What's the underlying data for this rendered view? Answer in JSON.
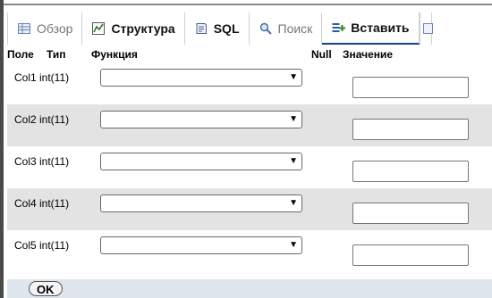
{
  "tabs": [
    {
      "label": "Обзор",
      "icon": "table-browse-icon",
      "style": "dim"
    },
    {
      "label": "Структура",
      "icon": "structure-icon",
      "style": "bold"
    },
    {
      "label": "SQL",
      "icon": "sql-icon",
      "style": "bold"
    },
    {
      "label": "Поиск",
      "icon": "search-icon",
      "style": "dim"
    },
    {
      "label": "Вставить",
      "icon": "insert-icon",
      "style": "bold"
    }
  ],
  "header": {
    "field": "Поле",
    "type": "Тип",
    "function": "Функция",
    "null": "Null",
    "value": "Значение"
  },
  "rows": [
    {
      "name": "Col1",
      "type": "int(11)",
      "function": "",
      "value": ""
    },
    {
      "name": "Col2",
      "type": "int(11)",
      "function": "",
      "value": ""
    },
    {
      "name": "Col3",
      "type": "int(11)",
      "function": "",
      "value": ""
    },
    {
      "name": "Col4",
      "type": "int(11)",
      "function": "",
      "value": ""
    },
    {
      "name": "Col5",
      "type": "int(11)",
      "function": "",
      "value": ""
    }
  ],
  "footer": {
    "ok_label": "OK"
  },
  "colors": {
    "zebra": "#e3e3e3",
    "footer_bg": "#dfe6ee",
    "active_tab_underline": "#1a3e8a"
  }
}
